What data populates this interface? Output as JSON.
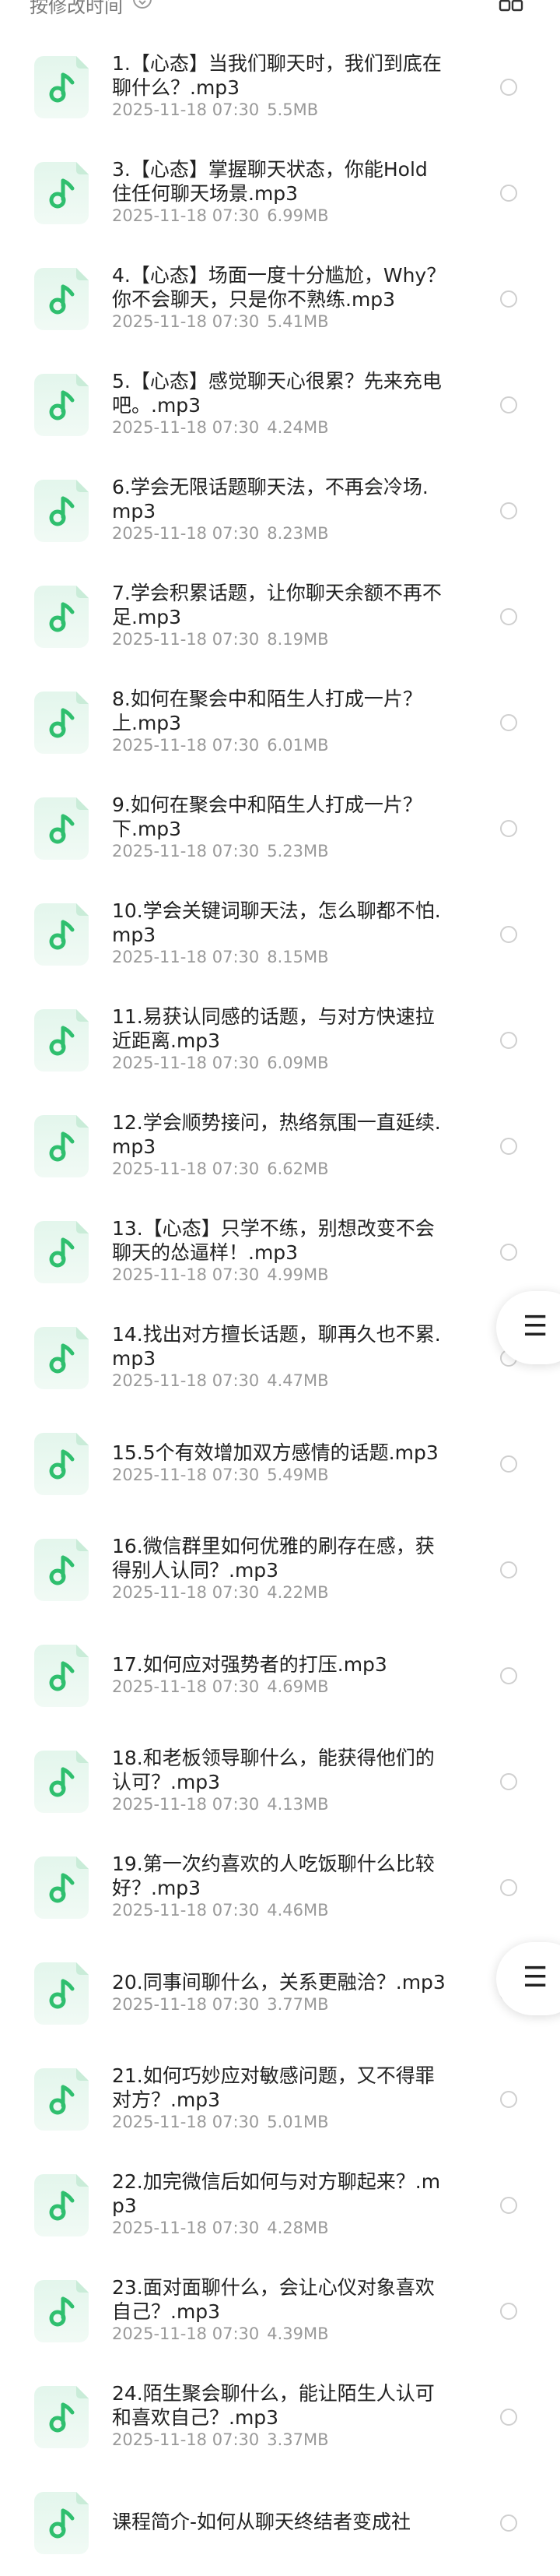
{
  "header": {
    "sort_label": "按修改时间",
    "sort_icon": "sort-arrows-icon",
    "view_icon": "grid-view-icon"
  },
  "files": [
    {
      "name": "1.【心态】当我们聊天时，我们到底在聊什么？.mp3",
      "date": "2025-11-18 07:30",
      "size": "5.5MB"
    },
    {
      "name": "3.【心态】掌握聊天状态，你能Hold住任何聊天场景.mp3",
      "date": "2025-11-18 07:30",
      "size": "6.99MB"
    },
    {
      "name": "4.【心态】场面一度十分尴尬，Why？你不会聊天，只是你不熟练.mp3",
      "date": "2025-11-18 07:30",
      "size": "5.41MB"
    },
    {
      "name": "5.【心态】感觉聊天心很累？先来充电吧。.mp3",
      "date": "2025-11-18 07:30",
      "size": "4.24MB"
    },
    {
      "name": "6.学会无限话题聊天法，不再会冷场.mp3",
      "date": "2025-11-18 07:30",
      "size": "8.23MB"
    },
    {
      "name": "7.学会积累话题，让你聊天余额不再不足.mp3",
      "date": "2025-11-18 07:30",
      "size": "8.19MB"
    },
    {
      "name": "8.如何在聚会中和陌生人打成一片？上.mp3",
      "date": "2025-11-18 07:30",
      "size": "6.01MB"
    },
    {
      "name": "9.如何在聚会中和陌生人打成一片？下.mp3",
      "date": "2025-11-18 07:30",
      "size": "5.23MB"
    },
    {
      "name": "10.学会关键词聊天法，怎么聊都不怕.mp3",
      "date": "2025-11-18 07:30",
      "size": "8.15MB"
    },
    {
      "name": "11.易获认同感的话题，与对方快速拉近距离.mp3",
      "date": "2025-11-18 07:30",
      "size": "6.09MB"
    },
    {
      "name": "12.学会顺势接问，热络氛围一直延续.mp3",
      "date": "2025-11-18 07:30",
      "size": "6.62MB"
    },
    {
      "name": "13.【心态】只学不练，别想改变不会聊天的怂逼样！.mp3",
      "date": "2025-11-18 07:30",
      "size": "4.99MB"
    },
    {
      "name": "14.找出对方擅长话题，聊再久也不累.mp3",
      "date": "2025-11-18 07:30",
      "size": "4.47MB"
    },
    {
      "name": "15.5个有效增加双方感情的话题.mp3",
      "date": "2025-11-18 07:30",
      "size": "5.49MB"
    },
    {
      "name": "16.微信群里如何优雅的刷存在感，获得别人认同？.mp3",
      "date": "2025-11-18 07:30",
      "size": "4.22MB"
    },
    {
      "name": "17.如何应对强势者的打压.mp3",
      "date": "2025-11-18 07:30",
      "size": "4.69MB"
    },
    {
      "name": "18.和老板领导聊什么，能获得他们的认可？.mp3",
      "date": "2025-11-18 07:30",
      "size": "4.13MB"
    },
    {
      "name": "19.第一次约喜欢的人吃饭聊什么比较好？.mp3",
      "date": "2025-11-18 07:30",
      "size": "4.46MB"
    },
    {
      "name": "20.同事间聊什么，关系更融洽？.mp3",
      "date": "2025-11-18 07:30",
      "size": "3.77MB"
    },
    {
      "name": "21.如何巧妙应对敏感问题，又不得罪对方？.mp3",
      "date": "2025-11-18 07:30",
      "size": "5.01MB"
    },
    {
      "name": "22.加完微信后如何与对方聊起来？.mp3",
      "date": "2025-11-18 07:30",
      "size": "4.28MB"
    },
    {
      "name": "23.面对面聊什么，会让心仪对象喜欢自己？.mp3",
      "date": "2025-11-18 07:30",
      "size": "4.39MB"
    },
    {
      "name": "24.陌生聚会聊什么，能让陌生人认可和喜欢自己？.mp3",
      "date": "2025-11-18 07:30",
      "size": "3.37MB"
    },
    {
      "name": "课程简介-如何从聊天终结者变成社",
      "date": "",
      "size": ""
    }
  ],
  "floating_menu_icon": "hamburger-menu-icon",
  "colors": {
    "accent_green": "#2fbf6e",
    "thumb_bg": "#e6f7ee",
    "text_primary": "#222222",
    "text_secondary": "#9a9a9a",
    "radio_border": "#cfcfcf"
  }
}
